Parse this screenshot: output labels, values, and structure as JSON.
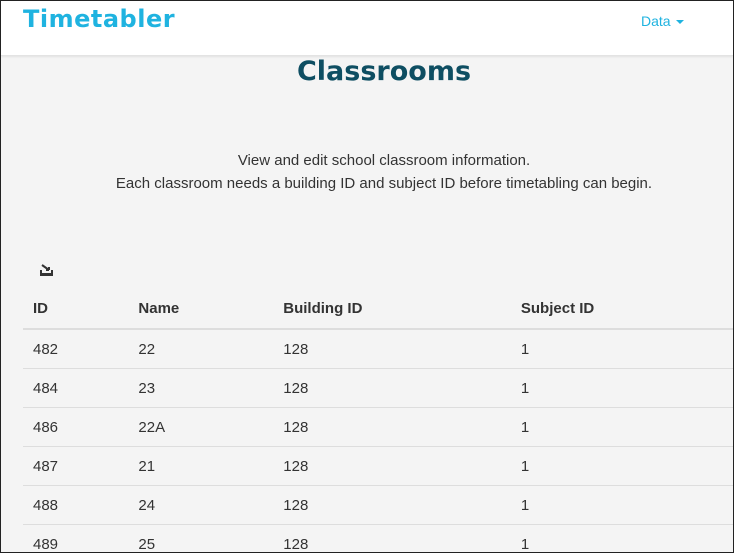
{
  "colors": {
    "brand": "#1fb3e0",
    "title": "#0e4e62",
    "nav_link": "#1fb3e0",
    "border": "#dddddd"
  },
  "navbar": {
    "brand": "Timetabler",
    "dropdown_label": "Data"
  },
  "page": {
    "title": "Classrooms",
    "intro_line1": "View and edit school classroom information.",
    "intro_line2": "Each classroom needs a building ID and subject ID before timetabling can begin."
  },
  "toolbar": {
    "export_icon": "export-icon"
  },
  "table": {
    "headers": [
      "ID",
      "Name",
      "Building ID",
      "Subject ID"
    ],
    "rows": [
      [
        "482",
        "22",
        "128",
        "1"
      ],
      [
        "484",
        "23",
        "128",
        "1"
      ],
      [
        "486",
        "22A",
        "128",
        "1"
      ],
      [
        "487",
        "21",
        "128",
        "1"
      ],
      [
        "488",
        "24",
        "128",
        "1"
      ],
      [
        "489",
        "25",
        "128",
        "1"
      ]
    ]
  }
}
